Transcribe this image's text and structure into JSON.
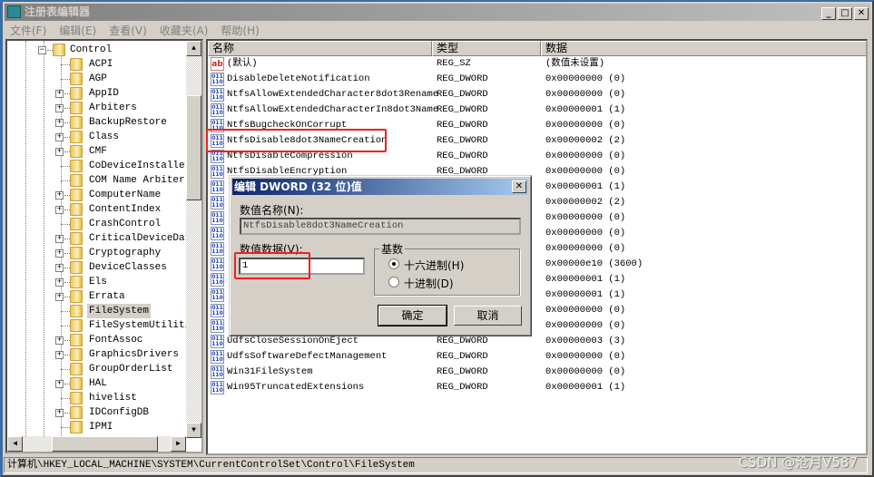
{
  "window": {
    "title": "注册表编辑器",
    "minimize": "_",
    "maximize": "□",
    "close": "✕"
  },
  "menu": [
    "文件(F)",
    "编辑(E)",
    "查看(V)",
    "收藏夹(A)",
    "帮助(H)"
  ],
  "tree": {
    "parent": "Control",
    "items": [
      {
        "label": "ACPI",
        "expandable": false
      },
      {
        "label": "AGP",
        "expandable": false
      },
      {
        "label": "AppID",
        "expandable": true
      },
      {
        "label": "Arbiters",
        "expandable": true
      },
      {
        "label": "BackupRestore",
        "expandable": true
      },
      {
        "label": "Class",
        "expandable": true
      },
      {
        "label": "CMF",
        "expandable": true
      },
      {
        "label": "CoDeviceInstallers",
        "expandable": false
      },
      {
        "label": "COM Name Arbiter",
        "expandable": false
      },
      {
        "label": "ComputerName",
        "expandable": true
      },
      {
        "label": "ContentIndex",
        "expandable": true
      },
      {
        "label": "CrashControl",
        "expandable": false
      },
      {
        "label": "CriticalDeviceData",
        "expandable": true
      },
      {
        "label": "Cryptography",
        "expandable": true
      },
      {
        "label": "DeviceClasses",
        "expandable": true
      },
      {
        "label": "Els",
        "expandable": true
      },
      {
        "label": "Errata",
        "expandable": true
      },
      {
        "label": "FileSystem",
        "expandable": false,
        "selected": true
      },
      {
        "label": "FileSystemUtilitie",
        "expandable": false
      },
      {
        "label": "FontAssoc",
        "expandable": true
      },
      {
        "label": "GraphicsDrivers",
        "expandable": true
      },
      {
        "label": "GroupOrderList",
        "expandable": false
      },
      {
        "label": "HAL",
        "expandable": true
      },
      {
        "label": "hivelist",
        "expandable": false
      },
      {
        "label": "IDConfigDB",
        "expandable": true
      },
      {
        "label": "IPMI",
        "expandable": false
      }
    ]
  },
  "list": {
    "columns": [
      "名称",
      "类型",
      "数据"
    ],
    "rows": [
      {
        "name": "(默认)",
        "type": "REG_SZ",
        "data": "(数值未设置)",
        "icon": "string-value-icon"
      },
      {
        "name": "DisableDeleteNotification",
        "type": "REG_DWORD",
        "data": "0x00000000 (0)"
      },
      {
        "name": "NtfsAllowExtendedCharacter8dot3Rename",
        "type": "REG_DWORD",
        "data": "0x00000000 (0)"
      },
      {
        "name": "NtfsAllowExtendedCharacterIn8dot3Name",
        "type": "REG_DWORD",
        "data": "0x00000001 (1)"
      },
      {
        "name": "NtfsBugcheckOnCorrupt",
        "type": "REG_DWORD",
        "data": "0x00000000 (0)"
      },
      {
        "name": "NtfsDisable8dot3NameCreation",
        "type": "REG_DWORD",
        "data": "0x00000002 (2)"
      },
      {
        "name": "NtfsDisableCompression",
        "type": "REG_DWORD",
        "data": "0x00000000 (0)"
      },
      {
        "name": "NtfsDisableEncryption",
        "type": "REG_DWORD",
        "data": "0x00000000 (0)"
      },
      {
        "name": "",
        "type": "",
        "data": "0x00000001 (1)"
      },
      {
        "name": "",
        "type": "",
        "data": "0x00000002 (2)"
      },
      {
        "name": "",
        "type": "",
        "data": "0x00000000 (0)"
      },
      {
        "name": "",
        "type": "",
        "data": "0x00000000 (0)"
      },
      {
        "name": "",
        "type": "",
        "data": "0x00000000 (0)"
      },
      {
        "name": "",
        "type": "",
        "data": "0x00000e10 (3600)"
      },
      {
        "name": "",
        "type": "",
        "data": "0x00000001 (1)"
      },
      {
        "name": "",
        "type": "",
        "data": "0x00000001 (1)"
      },
      {
        "name": "",
        "type": "",
        "data": "0x00000000 (0)"
      },
      {
        "name": "",
        "type": "",
        "data": "0x00000000 (0)"
      },
      {
        "name": "UdfsCloseSessionOnEject",
        "type": "REG_DWORD",
        "data": "0x00000003 (3)"
      },
      {
        "name": "UdfsSoftwareDefectManagement",
        "type": "REG_DWORD",
        "data": "0x00000000 (0)"
      },
      {
        "name": "Win31FileSystem",
        "type": "REG_DWORD",
        "data": "0x00000000 (0)"
      },
      {
        "name": "Win95TruncatedExtensions",
        "type": "REG_DWORD",
        "data": "0x00000001 (1)"
      }
    ]
  },
  "dialog": {
    "title": "编辑 DWORD (32 位)值",
    "close": "✕",
    "name_label": "数值名称(N):",
    "name_value": "NtfsDisable8dot3NameCreation",
    "data_label": "数值数据(V):",
    "data_value": "1",
    "base_label": "基数",
    "hex_label": "十六进制(H)",
    "dec_label": "十进制(D)",
    "base_selected": "hex",
    "ok": "确定",
    "cancel": "取消"
  },
  "status": "计算机\\HKEY_LOCAL_MACHINE\\SYSTEM\\CurrentControlSet\\Control\\FileSystem",
  "watermark": "CSDN @沧月V587",
  "colors": {
    "highlight": "#f02020",
    "dialog_title": "#0a246a"
  }
}
